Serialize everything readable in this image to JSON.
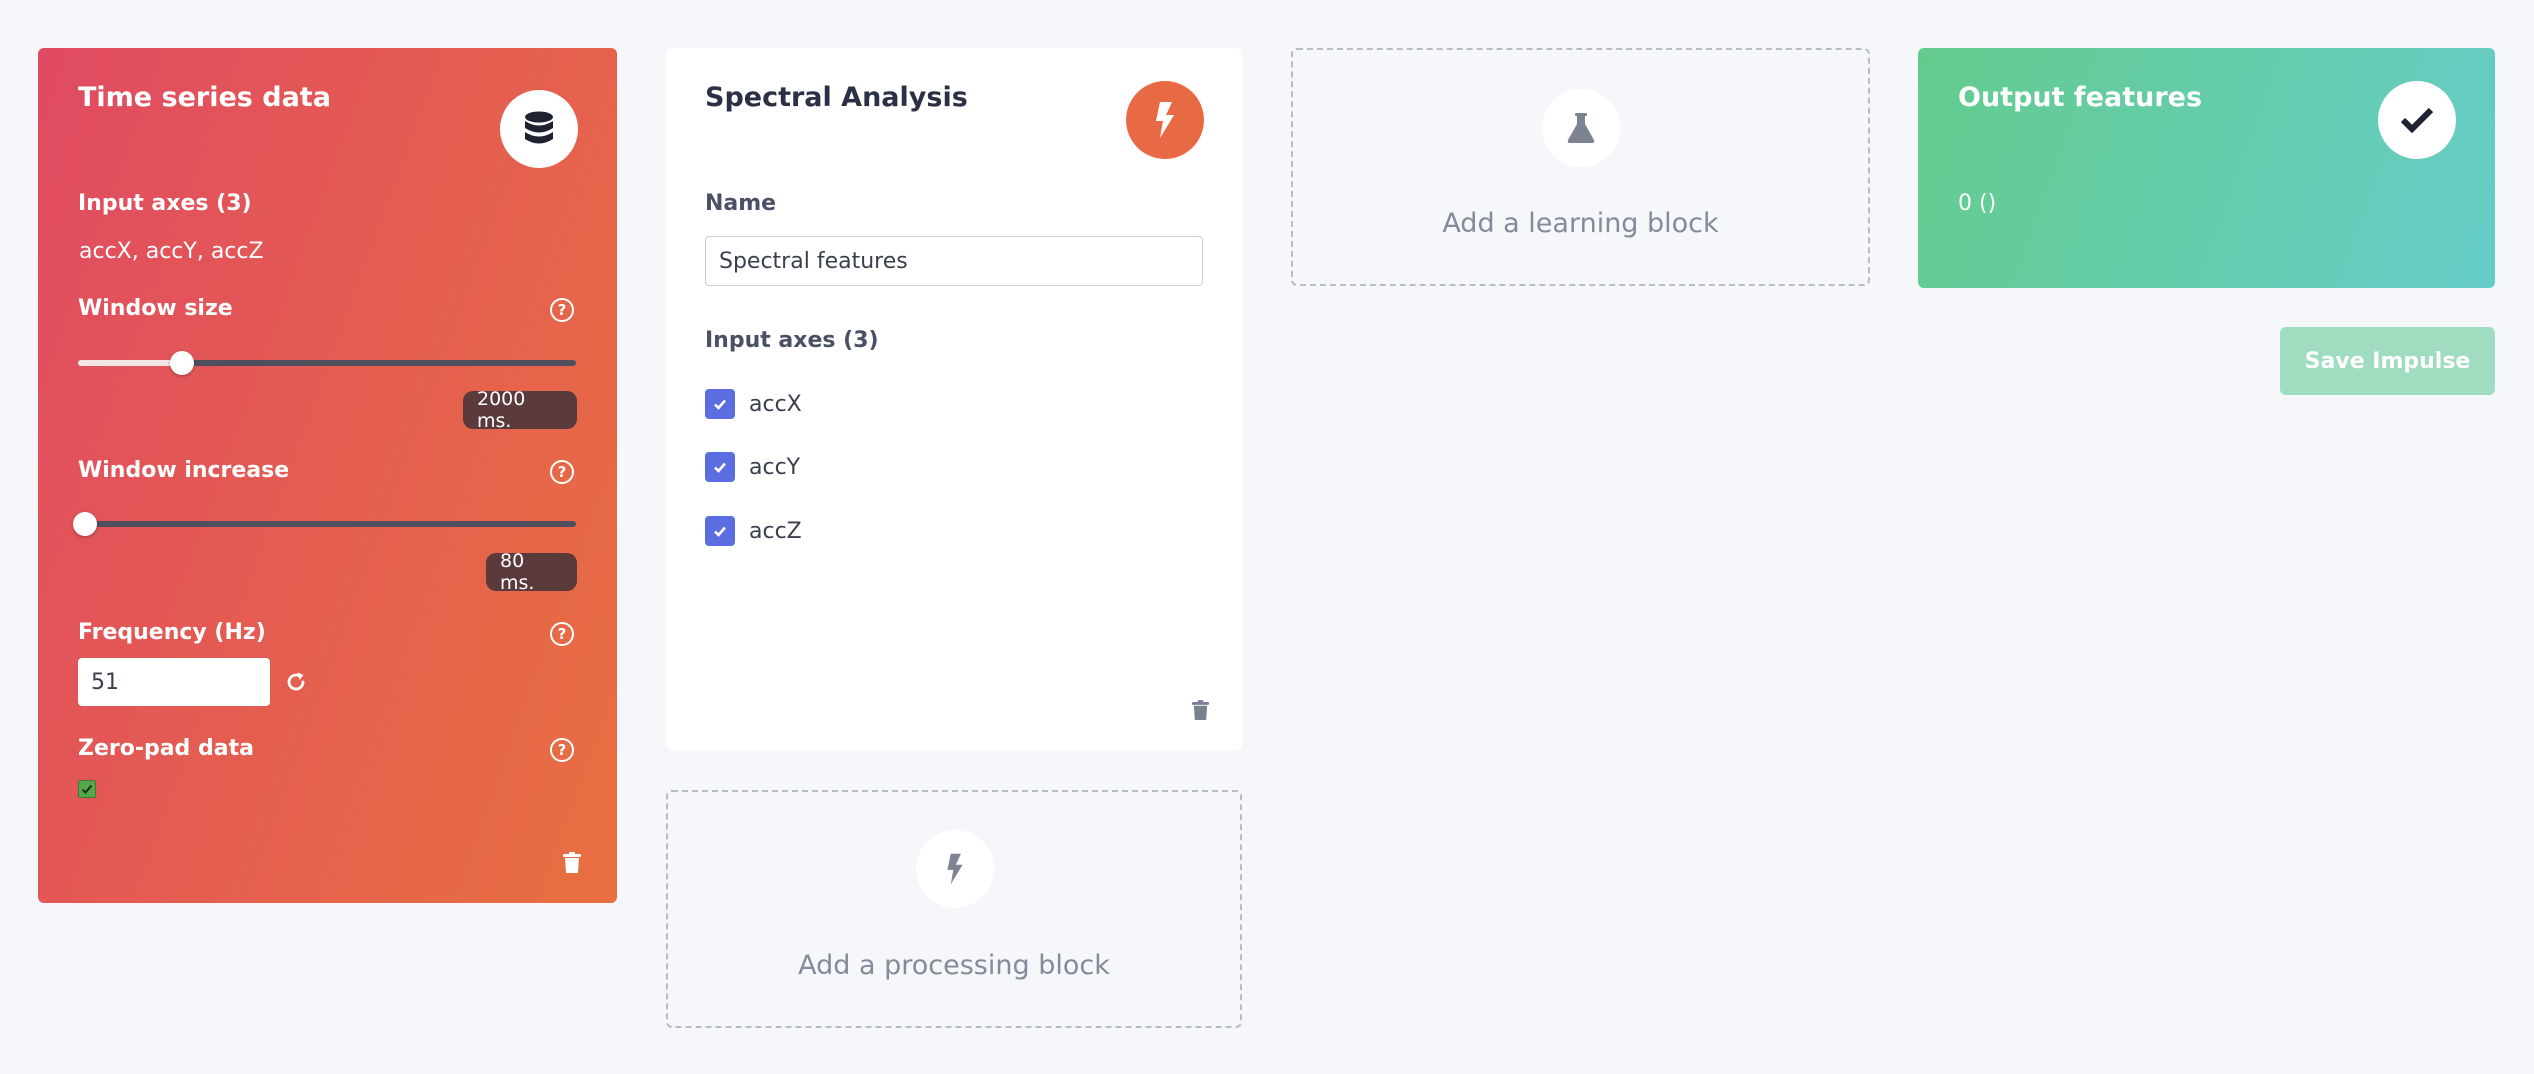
{
  "colors": {
    "ts_gradient_start": "#e04a62",
    "ts_gradient_end": "#e87040",
    "spectral_accent": "#e86a45",
    "output_gradient_start": "#63cc8c",
    "output_gradient_end": "#66ccc9",
    "checkbox_blue": "#5b6ee1",
    "save_button": "#9fdcc0"
  },
  "time_series": {
    "title": "Time series data",
    "icon": "database-icon",
    "input_axes_label": "Input axes (3)",
    "input_axes_value": "accX, accY, accZ",
    "window_size": {
      "label": "Window size",
      "value_text": "2000 ms.",
      "slider_fraction": 0.21
    },
    "window_increase": {
      "label": "Window increase",
      "value_text": "80 ms.",
      "slider_fraction": 0.0
    },
    "frequency": {
      "label": "Frequency (Hz)",
      "value": "51"
    },
    "zero_pad": {
      "label": "Zero-pad data",
      "checked": true
    }
  },
  "spectral": {
    "title": "Spectral Analysis",
    "icon": "lightning-icon",
    "name_label": "Name",
    "name_value": "Spectral features",
    "input_axes_label": "Input axes (3)",
    "axes": [
      {
        "label": "accX",
        "checked": true
      },
      {
        "label": "accY",
        "checked": true
      },
      {
        "label": "accZ",
        "checked": true
      }
    ]
  },
  "add_processing": {
    "label": "Add a processing block",
    "icon": "lightning-icon"
  },
  "add_learning": {
    "label": "Add a learning block",
    "icon": "flask-icon"
  },
  "output": {
    "title": "Output features",
    "icon": "check-icon",
    "value": "0 ()"
  },
  "save_button": {
    "label": "Save Impulse"
  }
}
